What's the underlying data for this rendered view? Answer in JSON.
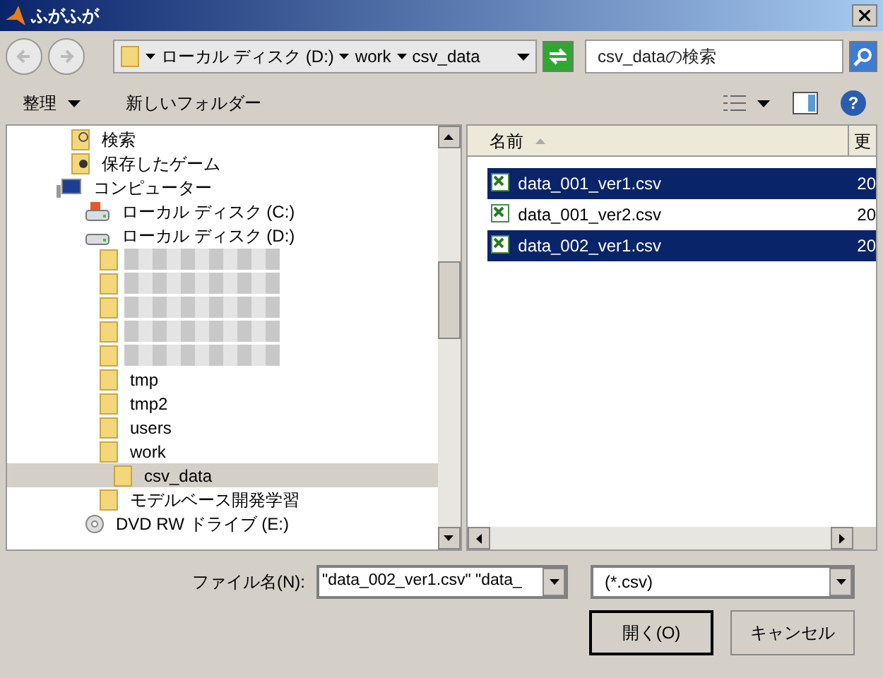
{
  "window": {
    "title": "ふがふが"
  },
  "address": {
    "path": [
      "ローカル ディスク (D:)",
      "work",
      "csv_data"
    ]
  },
  "search": {
    "placeholder": "csv_dataの検索"
  },
  "toolbar": {
    "organize": "整理",
    "new_folder": "新しいフォルダー",
    "help": "?"
  },
  "tree": [
    {
      "label": "検索",
      "kind": "search",
      "selected": false
    },
    {
      "label": "保存したゲーム",
      "kind": "games",
      "selected": false
    },
    {
      "label": "コンピューター",
      "kind": "computer",
      "selected": false,
      "children": [
        {
          "label": "ローカル ディスク (C:)",
          "kind": "sysdrive",
          "selected": false
        },
        {
          "label": "ローカル ディスク (D:)",
          "kind": "drive",
          "selected": false,
          "children": [
            {
              "kind": "redacted",
              "selected": false
            },
            {
              "kind": "redacted",
              "selected": false
            },
            {
              "kind": "redacted",
              "selected": false
            },
            {
              "kind": "redacted",
              "selected": false
            },
            {
              "kind": "redacted",
              "selected": false
            },
            {
              "label": "tmp",
              "kind": "folder",
              "selected": false
            },
            {
              "label": "tmp2",
              "kind": "folder",
              "selected": false
            },
            {
              "label": "users",
              "kind": "folder",
              "selected": false
            },
            {
              "label": "work",
              "kind": "folder",
              "selected": false,
              "children": [
                {
                  "label": "csv_data",
                  "kind": "folder",
                  "selected": true
                }
              ]
            },
            {
              "label": "モデルベース開発学習",
              "kind": "folder",
              "selected": false
            }
          ]
        },
        {
          "label": "DVD RW ドライブ (E:)",
          "kind": "dvd",
          "selected": false
        }
      ]
    }
  ],
  "files": {
    "columns": [
      {
        "label": "名前"
      },
      {
        "label": "更"
      }
    ],
    "rows": [
      {
        "name": "data_001_ver1.csv",
        "column_2": "20",
        "selected": true
      },
      {
        "name": "data_001_ver2.csv",
        "column_2": "20",
        "selected": false
      },
      {
        "name": "data_002_ver1.csv",
        "column_2": "20",
        "selected": true
      }
    ]
  },
  "filename": {
    "label": "ファイル名(N):",
    "value": "\"data_002_ver1.csv\" \"data_"
  },
  "filter": {
    "value": "(*.csv)"
  },
  "buttons": [
    {
      "label": "開く(O)",
      "kind": "default"
    },
    {
      "label": "キャンセル",
      "kind": "normal"
    }
  ]
}
